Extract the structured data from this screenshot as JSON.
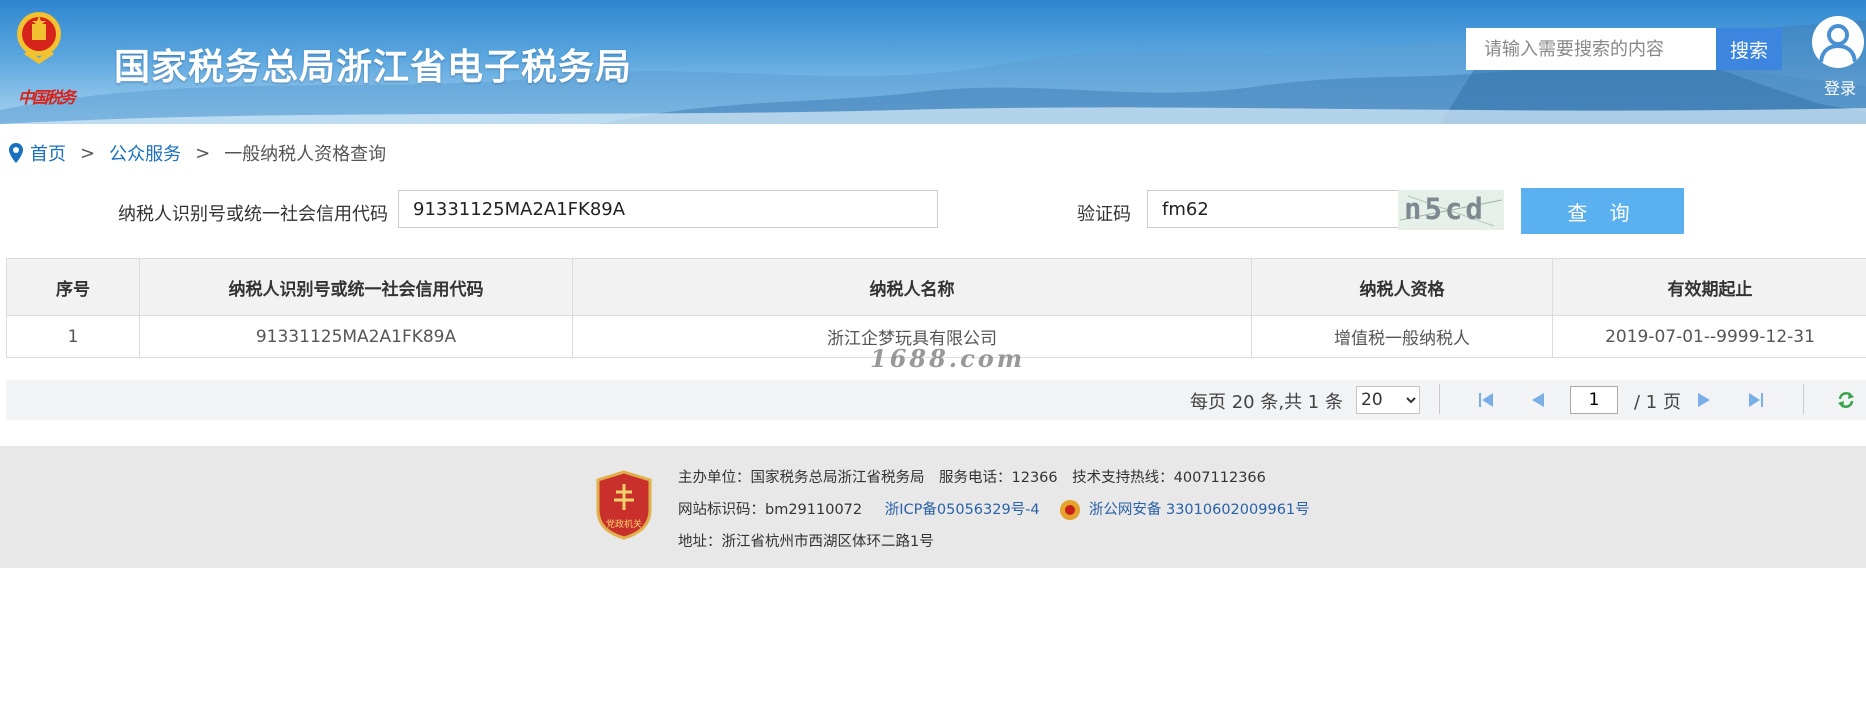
{
  "header": {
    "title": "国家税务总局浙江省电子税务局",
    "emblem_sub": "中国税务",
    "search_placeholder": "请输入需要搜索的内容",
    "search_button": "搜索",
    "login_label": "登录"
  },
  "breadcrumb": {
    "home": "首页",
    "separator": ">",
    "public_service": "公众服务",
    "current": "一般纳税人资格查询"
  },
  "query_form": {
    "taxpayer_id_label": "纳税人识别号或统一社会信用代码",
    "taxpayer_id_value": "91331125MA2A1FK89A",
    "captcha_label": "验证码",
    "captcha_value": "fm62",
    "captcha_image_text": "n5cd",
    "query_button": "查 询"
  },
  "table": {
    "columns": [
      "序号",
      "纳税人识别号或统一社会信用代码",
      "纳税人名称",
      "纳税人资格",
      "有效期起止"
    ],
    "rows": [
      [
        "1",
        "91331125MA2A1FK89A",
        "浙江企梦玩具有限公司",
        "增值税一般纳税人",
        "2019-07-01--9999-12-31"
      ]
    ]
  },
  "watermark": "1688.com",
  "pager": {
    "info": "每页 20 条,共 1 条",
    "page_size": "20",
    "current_page": "1",
    "total_pages": "/ 1 页"
  },
  "footer": {
    "organizer": "主办单位：国家税务总局浙江省税务局　服务电话：12366　技术支持热线：4007112366",
    "site_code": "网站标识码：bm29110072",
    "icp": "浙ICP备05056329号-4",
    "police_record": "浙公网安备 33010602009961号",
    "address": "地址：浙江省杭州市西湖区体环二路1号",
    "badge_text": "党政机关"
  },
  "colors": {
    "header_blue": "#2f86cf",
    "link_blue": "#1a6fc1",
    "search_button": "#3d86df",
    "query_button": "#5bb0ef",
    "footer_bg": "#e8e8e8",
    "emblem_red": "#d6231b"
  },
  "icons": [
    "location-pin-icon",
    "user-avatar-icon",
    "first-page-icon",
    "prev-page-icon",
    "next-page-icon",
    "last-page-icon",
    "refresh-icon",
    "police-badge-icon",
    "party-government-badge-icon"
  ]
}
